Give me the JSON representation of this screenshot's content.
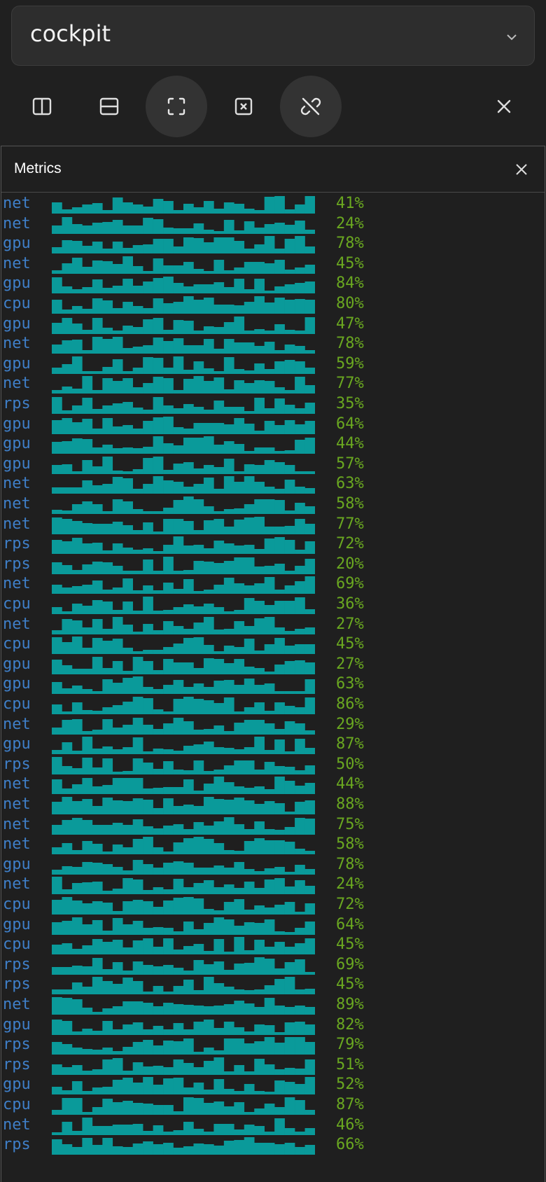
{
  "header": {
    "profile": "cockpit"
  },
  "toolbar": {
    "buttons": [
      {
        "name": "split-vertical-button",
        "icon": "split-vertical-icon"
      },
      {
        "name": "split-horizontal-button",
        "icon": "split-horizontal-icon"
      },
      {
        "name": "fullscreen-button",
        "icon": "fullscreen-icon",
        "active": true
      },
      {
        "name": "close-pane-button",
        "icon": "close-box-icon"
      },
      {
        "name": "unlink-button",
        "icon": "unlink-icon",
        "active": true
      },
      {
        "name": "close-button",
        "icon": "close-icon"
      }
    ]
  },
  "panel": {
    "title": "Metrics"
  },
  "colors": {
    "accent": "#0a9a9a",
    "metric_name": "#3f7fc8",
    "percent": "#6aa820",
    "background": "#202020"
  },
  "metrics": [
    {
      "name": "net",
      "value": "41%"
    },
    {
      "name": "net",
      "value": "24%"
    },
    {
      "name": "gpu",
      "value": "78%"
    },
    {
      "name": "net",
      "value": "45%"
    },
    {
      "name": "gpu",
      "value": "84%"
    },
    {
      "name": "cpu",
      "value": "80%"
    },
    {
      "name": "gpu",
      "value": "47%"
    },
    {
      "name": "net",
      "value": "78%"
    },
    {
      "name": "gpu",
      "value": "59%"
    },
    {
      "name": "net",
      "value": "77%"
    },
    {
      "name": " rps",
      "value": "35%"
    },
    {
      "name": "gpu",
      "value": "64%"
    },
    {
      "name": "gpu",
      "value": "44%"
    },
    {
      "name": "gpu",
      "value": "57%"
    },
    {
      "name": "net",
      "value": "63%"
    },
    {
      "name": "net",
      "value": "58%"
    },
    {
      "name": "net",
      "value": "77%"
    },
    {
      "name": " rps",
      "value": "72%"
    },
    {
      "name": " rps",
      "value": "20%"
    },
    {
      "name": "net",
      "value": "69%"
    },
    {
      "name": "cpu",
      "value": "36%"
    },
    {
      "name": "net",
      "value": "27%"
    },
    {
      "name": "cpu",
      "value": "45%"
    },
    {
      "name": "gpu",
      "value": "27%"
    },
    {
      "name": "gpu",
      "value": "63%"
    },
    {
      "name": "cpu",
      "value": "86%"
    },
    {
      "name": "net",
      "value": "29%"
    },
    {
      "name": "gpu",
      "value": "87%"
    },
    {
      "name": " rps",
      "value": "50%"
    },
    {
      "name": "net",
      "value": "44%"
    },
    {
      "name": "net",
      "value": "88%"
    },
    {
      "name": "net",
      "value": "75%"
    },
    {
      "name": "net",
      "value": "58%"
    },
    {
      "name": "gpu",
      "value": "78%"
    },
    {
      "name": "net",
      "value": "24%"
    },
    {
      "name": "cpu",
      "value": "72%"
    },
    {
      "name": "gpu",
      "value": "64%"
    },
    {
      "name": "cpu",
      "value": "45%"
    },
    {
      "name": " rps",
      "value": "69%"
    },
    {
      "name": " rps",
      "value": "45%"
    },
    {
      "name": "net",
      "value": "89%"
    },
    {
      "name": "gpu",
      "value": "82%"
    },
    {
      "name": " rps",
      "value": "79%"
    },
    {
      "name": " rps",
      "value": "51%"
    },
    {
      "name": "gpu",
      "value": "52%"
    },
    {
      "name": "cpu",
      "value": "87%"
    },
    {
      "name": "net",
      "value": "46%"
    },
    {
      "name": " rps",
      "value": "66%"
    }
  ]
}
